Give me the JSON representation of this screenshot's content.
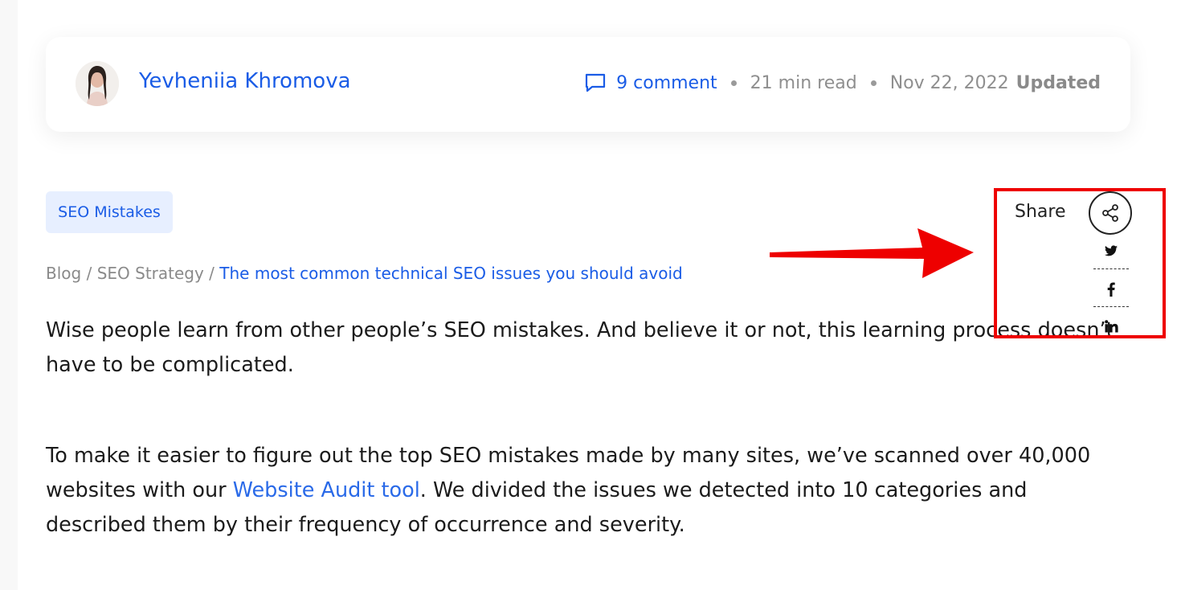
{
  "author": {
    "name": "Yevheniia Khromova"
  },
  "meta": {
    "comment_count": "9",
    "comment_label": "comment",
    "read_time": "21 min read",
    "date": "Nov 22, 2022",
    "updated_label": "Updated"
  },
  "tag": {
    "label": "SEO Mistakes"
  },
  "breadcrumb": {
    "items": [
      "Blog",
      "SEO Strategy"
    ],
    "separator": "/",
    "current": "The most common technical SEO issues you should avoid"
  },
  "share": {
    "label": "Share",
    "icons": [
      "share-icon",
      "twitter-icon",
      "facebook-icon",
      "linkedin-icon"
    ]
  },
  "article": {
    "p1": "Wise people learn from other people’s SEO mistakes. And believe it or not, this learning process doesn’t have to be complicated.",
    "p2_before": "To make it easier to figure out the top SEO mistakes made by many sites, we’ve scanned over 40,000 websites with our ",
    "p2_link": "Website Audit tool",
    "p2_after": ". We divided the issues we detected into 10 categories and described them by their frequency of occurrence and severity."
  },
  "colors": {
    "accent": "#1a5ce6",
    "annotation": "#ee0000"
  }
}
